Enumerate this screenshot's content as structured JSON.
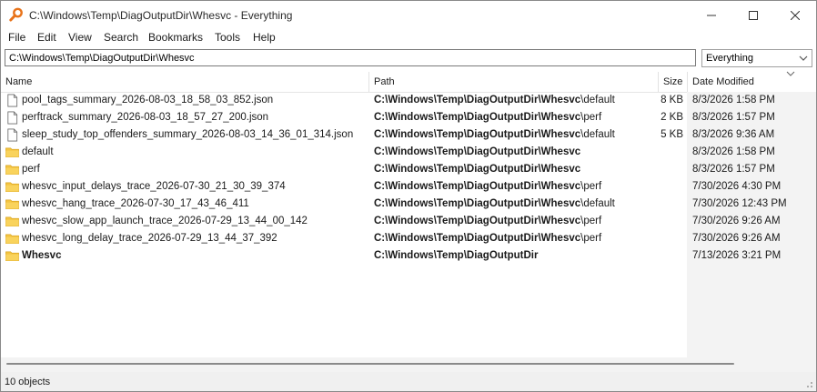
{
  "window": {
    "title": "C:\\Windows\\Temp\\DiagOutputDir\\Whesvc - Everything"
  },
  "menu": [
    "File",
    "Edit",
    "View",
    "Search",
    "Bookmarks",
    "Tools",
    "Help"
  ],
  "search": {
    "value": "C:\\Windows\\Temp\\DiagOutputDir\\Whesvc"
  },
  "filter": {
    "selected": "Everything"
  },
  "columns": {
    "name": "Name",
    "path": "Path",
    "size": "Size",
    "date": "Date Modified"
  },
  "rows": [
    {
      "name": "pool_tags_summary_2026-08-03_18_58_03_852.json",
      "type": "file",
      "path_bold": "C:\\Windows\\Temp\\DiagOutputDir\\Whesvc",
      "path_rest": "\\default",
      "size": "8 KB",
      "date": "8/3/2026 1:58 PM"
    },
    {
      "name": "perftrack_summary_2026-08-03_18_57_27_200.json",
      "type": "file",
      "path_bold": "C:\\Windows\\Temp\\DiagOutputDir\\Whesvc",
      "path_rest": "\\perf",
      "size": "2 KB",
      "date": "8/3/2026 1:57 PM"
    },
    {
      "name": "sleep_study_top_offenders_summary_2026-08-03_14_36_01_314.json",
      "type": "file",
      "path_bold": "C:\\Windows\\Temp\\DiagOutputDir\\Whesvc",
      "path_rest": "\\default",
      "size": "5 KB",
      "date": "8/3/2026 9:36 AM"
    },
    {
      "name": "default",
      "type": "folder",
      "path_bold": "C:\\Windows\\Temp\\DiagOutputDir\\Whesvc",
      "path_rest": "",
      "size": "",
      "date": "8/3/2026 1:58 PM"
    },
    {
      "name": "perf",
      "type": "folder",
      "path_bold": "C:\\Windows\\Temp\\DiagOutputDir\\Whesvc",
      "path_rest": "",
      "size": "",
      "date": "8/3/2026 1:57 PM"
    },
    {
      "name": "whesvc_input_delays_trace_2026-07-30_21_30_39_374",
      "type": "folder",
      "path_bold": "C:\\Windows\\Temp\\DiagOutputDir\\Whesvc",
      "path_rest": "\\perf",
      "size": "",
      "date": "7/30/2026 4:30 PM"
    },
    {
      "name": "whesvc_hang_trace_2026-07-30_17_43_46_411",
      "type": "folder",
      "path_bold": "C:\\Windows\\Temp\\DiagOutputDir\\Whesvc",
      "path_rest": "\\default",
      "size": "",
      "date": "7/30/2026 12:43 PM"
    },
    {
      "name": "whesvc_slow_app_launch_trace_2026-07-29_13_44_00_142",
      "type": "folder",
      "path_bold": "C:\\Windows\\Temp\\DiagOutputDir\\Whesvc",
      "path_rest": "\\perf",
      "size": "",
      "date": "7/30/2026 9:26 AM"
    },
    {
      "name": "whesvc_long_delay_trace_2026-07-29_13_44_37_392",
      "type": "folder",
      "path_bold": "C:\\Windows\\Temp\\DiagOutputDir\\Whesvc",
      "path_rest": "\\perf",
      "size": "",
      "date": "7/30/2026 9:26 AM"
    },
    {
      "name": "Whesvc",
      "type": "folder",
      "bold": true,
      "path_bold": "C:\\Windows\\Temp\\DiagOutputDir",
      "path_rest": "",
      "size": "",
      "date": "7/13/2026 3:21 PM"
    }
  ],
  "status": {
    "text": "10 objects"
  },
  "icons": {
    "app": "magnifier-icon",
    "file": "document-icon",
    "folder": "folder-icon"
  },
  "colors": {
    "folder": "#f4c542",
    "app_icon": "#e8731a"
  }
}
